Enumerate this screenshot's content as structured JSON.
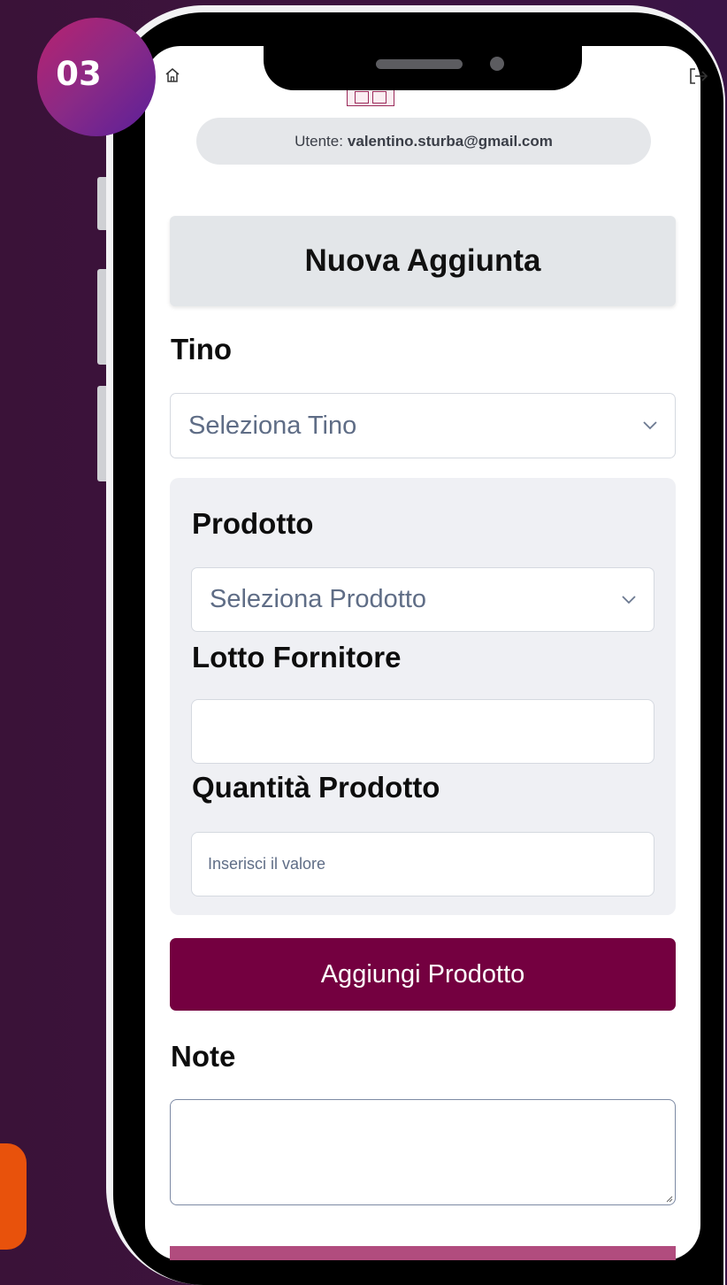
{
  "step_badge": {
    "number": "03"
  },
  "header": {
    "home_icon": "home-icon",
    "logout_icon": "logout-icon",
    "logo": "app-logo"
  },
  "user": {
    "label": "Utente:",
    "email": "valentino.sturba@gmail.com"
  },
  "page": {
    "title": "Nuova Aggiunta"
  },
  "tino": {
    "label": "Tino",
    "select_value": "Seleziona Tino"
  },
  "prodotto": {
    "label": "Prodotto",
    "select_value": "Seleziona Prodotto"
  },
  "lotto": {
    "label": "Lotto Fornitore",
    "value": ""
  },
  "quantita": {
    "label": "Quantità Prodotto",
    "placeholder": "Inserisci il valore"
  },
  "actions": {
    "add_product": "Aggiungi Prodotto"
  },
  "note": {
    "label": "Note",
    "value": ""
  },
  "colors": {
    "primary_button": "#740040",
    "badge_gradient": [
      "#b8226f",
      "#5a1f9a"
    ],
    "background": "#3e1440",
    "accent_tab": "#e8520c"
  }
}
